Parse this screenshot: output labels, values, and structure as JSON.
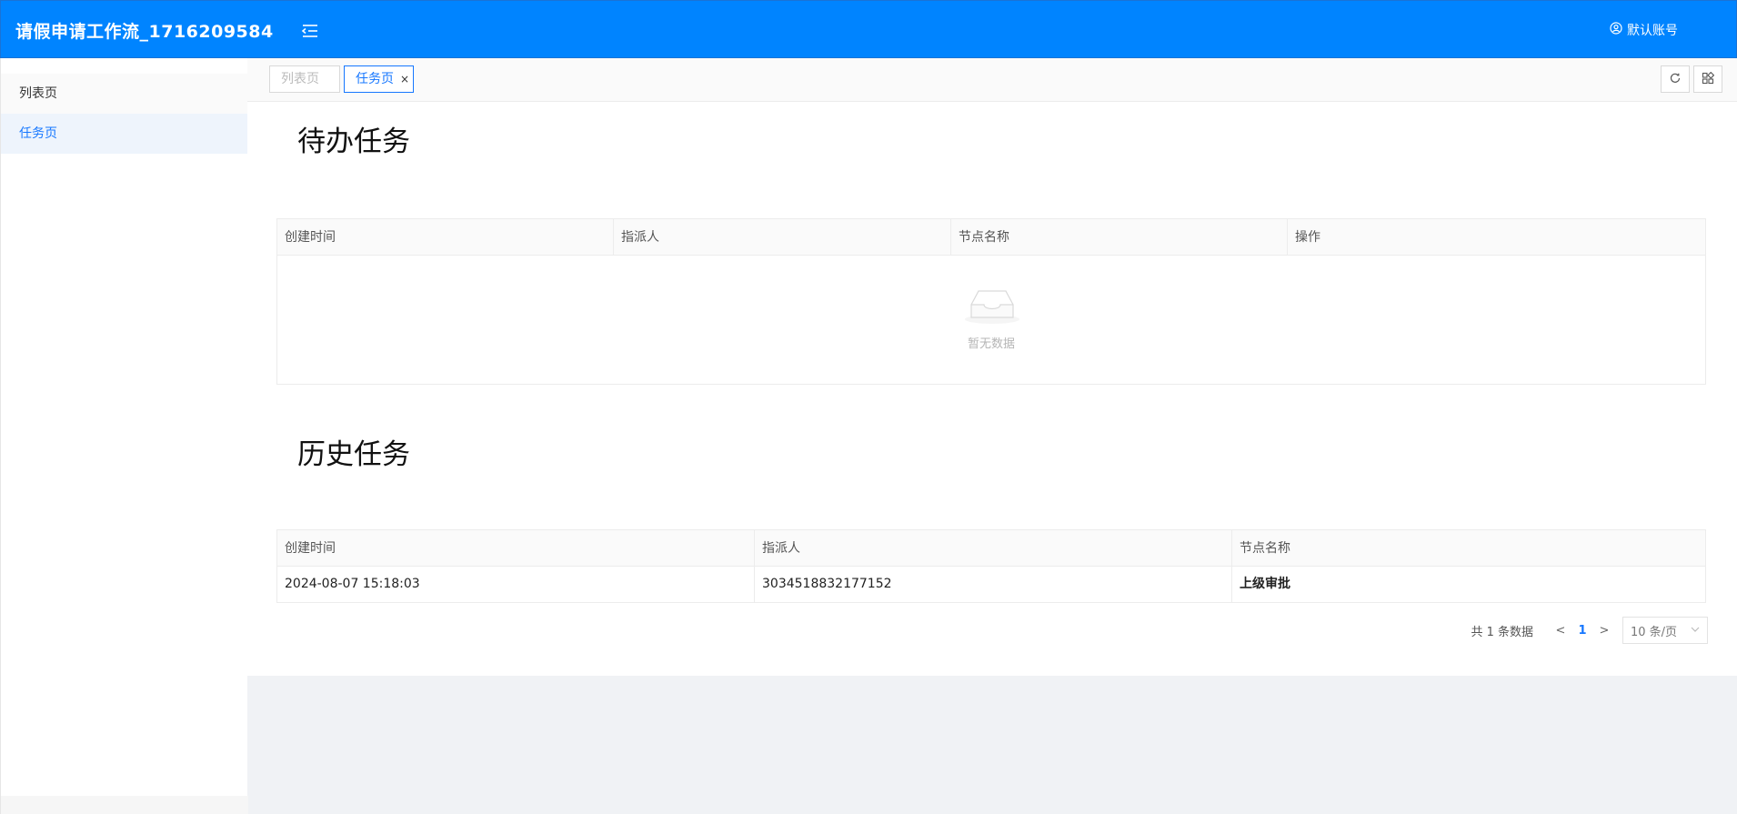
{
  "app": {
    "title": "请假申请工作流_1716209584",
    "account_label": "默认账号"
  },
  "sidebar": {
    "items": [
      {
        "label": "列表页"
      },
      {
        "label": "任务页"
      }
    ]
  },
  "tabs": [
    {
      "label": "列表页"
    },
    {
      "label": "任务页"
    }
  ],
  "tab_close": "×",
  "pending": {
    "title": "待办任务",
    "columns": [
      "创建时间",
      "指派人",
      "节点名称",
      "操作"
    ],
    "empty_text": "暂无数据"
  },
  "history": {
    "title": "历史任务",
    "columns": [
      "创建时间",
      "指派人",
      "节点名称"
    ],
    "rows": [
      [
        "2024-08-07 15:18:03",
        "3034518832177152",
        "上级审批"
      ]
    ]
  },
  "pagination": {
    "total_text": "共 1 条数据",
    "current_page": "1",
    "page_size": "10 条/页"
  },
  "colors": {
    "header": "#0084ff",
    "accent": "#1677ff",
    "background": "#f0f2f5"
  }
}
